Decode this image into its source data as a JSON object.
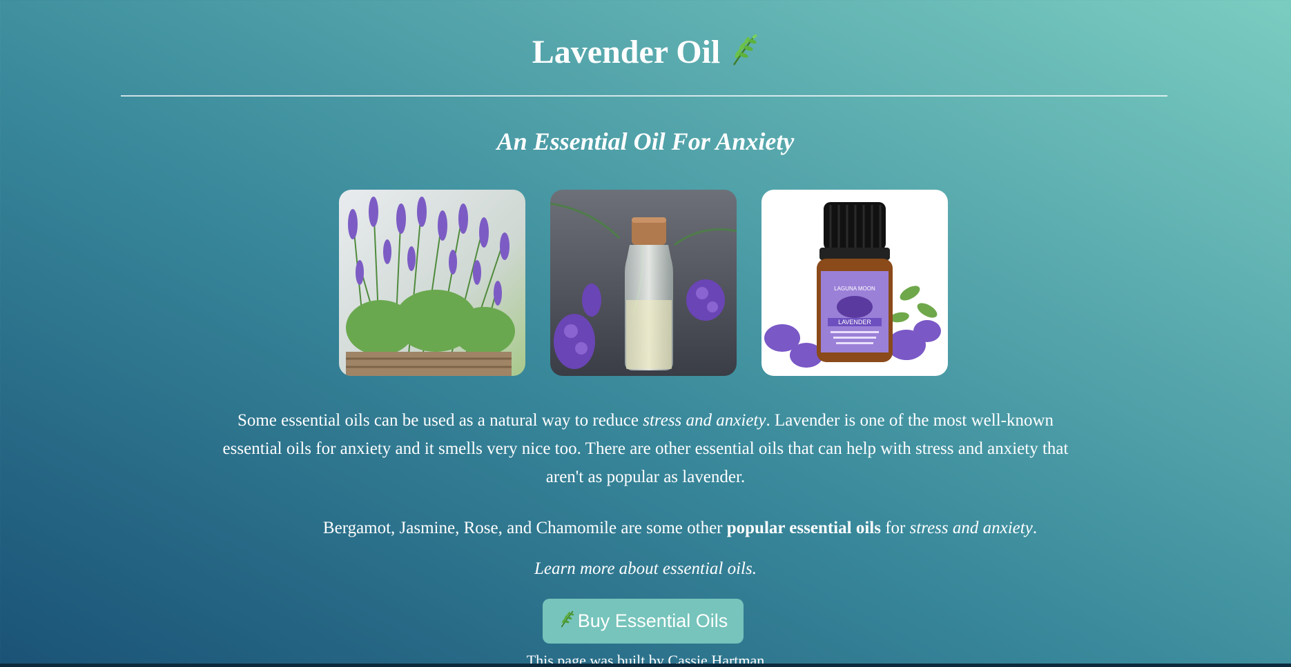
{
  "header": {
    "title": "Lavender Oil",
    "title_icon": "herb-icon",
    "subtitle": "An Essential Oil For Anxiety"
  },
  "gallery": {
    "images": [
      {
        "name": "lavender-plant-photo"
      },
      {
        "name": "oil-bottle-with-lavender-photo"
      },
      {
        "name": "lavender-oil-product-photo",
        "label_brand": "LAGUNA MOON",
        "label_product": "LAVENDER"
      }
    ]
  },
  "content": {
    "p1_a": "Some essential oils can be used as a natural way to reduce ",
    "p1_em": "stress and anxiety",
    "p1_b": ". Lavender is one of the most well-known essential oils for anxiety and it smells very nice too. There are other essential oils that can help with stress and anxiety that aren't as popular as lavender.",
    "p2_a": "Bergamot, Jasmine, Rose, and Chamomile are some other ",
    "p2_strong": "popular essential oils",
    "p2_b": " for ",
    "p2_em": "stress and anxiety",
    "p2_c": ".",
    "learn_more": "Learn more about essential oils."
  },
  "cta": {
    "label": "Buy Essential Oils",
    "icon": "herb-icon"
  },
  "footer": {
    "text": "This page was built by Cassie Hartman"
  },
  "colors": {
    "gradient_dark": "#1a5276",
    "gradient_light": "#7bcdc1",
    "button_bg": "#76c4bb",
    "text": "#ffffff"
  }
}
